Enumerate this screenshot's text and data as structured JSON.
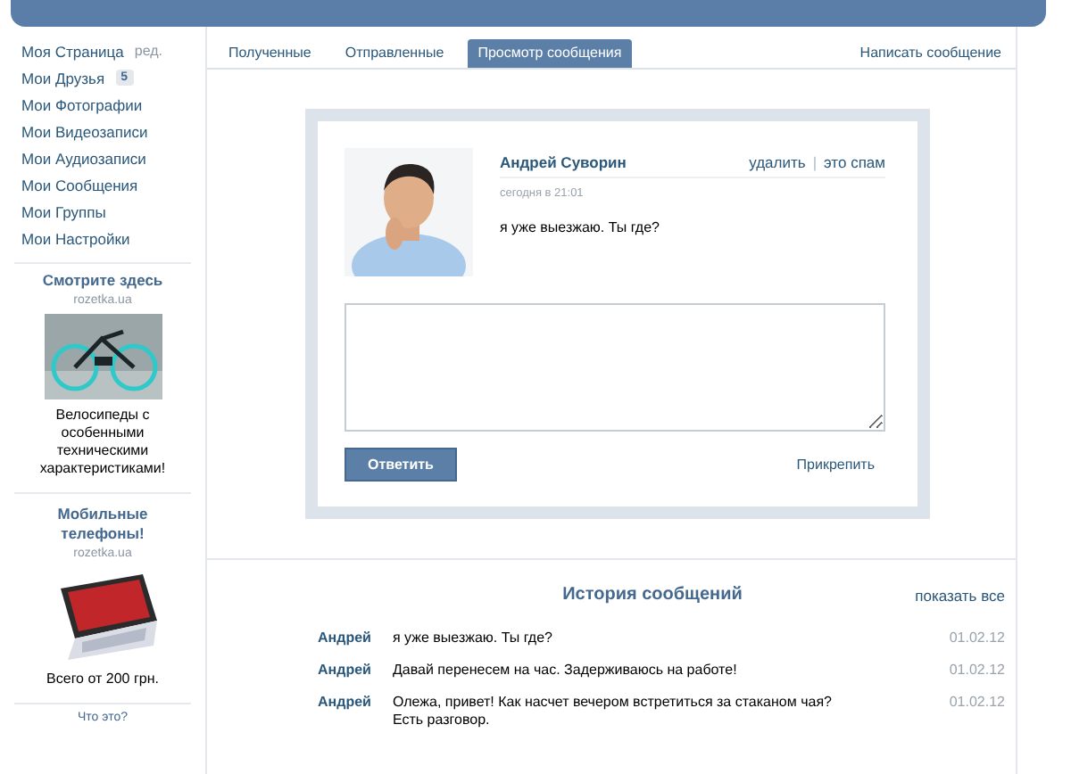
{
  "sidebar": {
    "menu": [
      {
        "label": "Моя Страница",
        "extra": "ред."
      },
      {
        "label": "Мои Друзья",
        "badge": "5"
      },
      {
        "label": "Мои Фотографии"
      },
      {
        "label": "Мои Видеозаписи"
      },
      {
        "label": "Мои Аудиозаписи"
      },
      {
        "label": "Мои Сообщения"
      },
      {
        "label": "Мои Группы"
      },
      {
        "label": "Мои Настройки"
      }
    ],
    "ads": [
      {
        "title": "Смотрите здесь",
        "source": "rozetka.ua",
        "kind": "picture",
        "text": "Велосипеды с особенными техническими характеристиками!"
      },
      {
        "title": "Мобильные телефоны!",
        "source": "rozetka.ua",
        "kind": "picture",
        "text": "Всего от 200 грн."
      }
    ],
    "about": "Что это?"
  },
  "tabs": [
    {
      "label": "Полученные",
      "selected": false
    },
    {
      "label": "Отправленные",
      "selected": false
    },
    {
      "label": "Просмотр сообщения",
      "selected": true
    }
  ],
  "compose_link": "Написать сообщение",
  "message": {
    "author": "Андрей Суворин",
    "actions": [
      "удалить",
      "это спам"
    ],
    "separator": "|",
    "time": "сегодня в 21:01",
    "text": "я уже выезжаю. Ты где?",
    "reply_button": "Ответить",
    "attach_link": "Прикрепить"
  },
  "history": {
    "title": "История сообщений",
    "show_all": "показать все",
    "rows": [
      {
        "author": "Андрей",
        "text": "я уже выезжаю. Ты где?",
        "date": "01.02.12"
      },
      {
        "author": "Андрей",
        "text": "Давай перенесем на час. Задерживаюсь на работе!",
        "date": "01.02.12"
      },
      {
        "author": "Андрей",
        "text": "Олежа, привет! Как насчет вечером встретиться за стаканом чая? Есть разговор.",
        "date": "01.02.12"
      }
    ]
  }
}
